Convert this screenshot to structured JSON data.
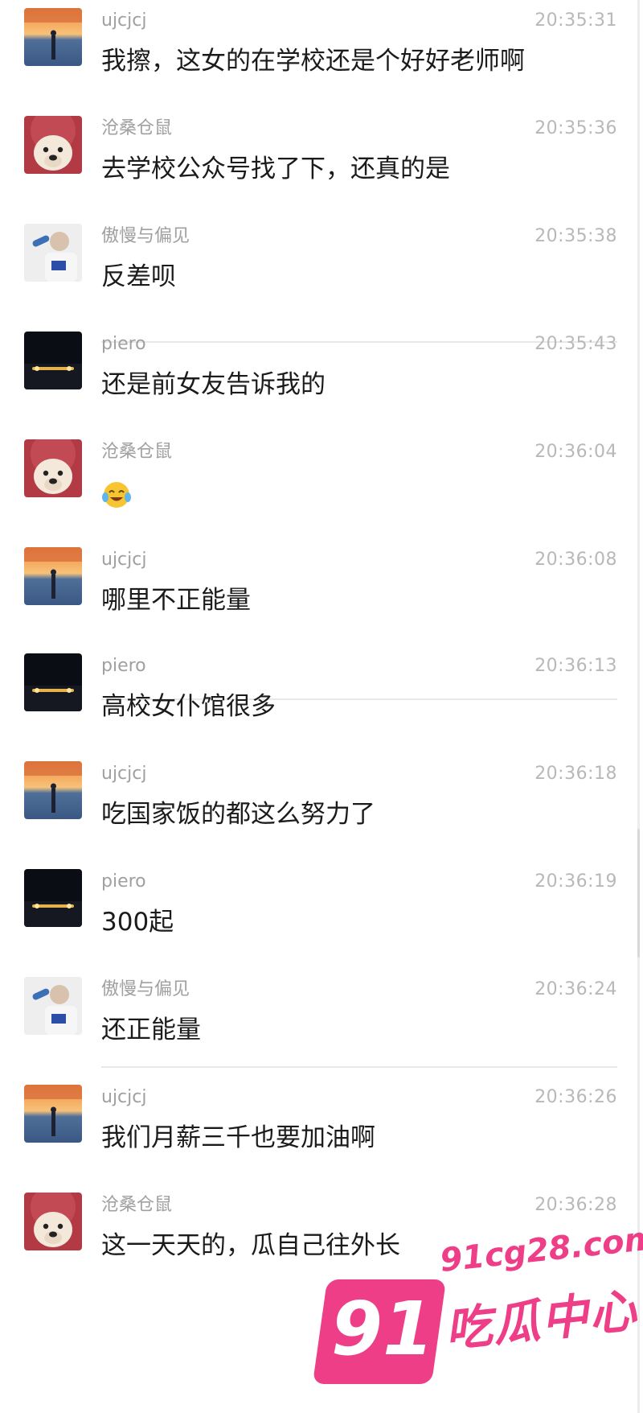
{
  "messages": [
    {
      "name": "ujcjcj",
      "time": "20:35:31",
      "text": "我擦，这女的在学校还是个好好老师啊",
      "avatar_icon": "sunset-silhouette-avatar"
    },
    {
      "name": "沧桑仓鼠",
      "time": "20:35:36",
      "text": "去学校公众号找了下，还真的是",
      "avatar_icon": "dog-red-hat-avatar"
    },
    {
      "name": "傲慢与偏见",
      "time": "20:35:38",
      "text": "反差呗",
      "avatar_icon": "man-drinking-avatar"
    },
    {
      "name": "piero",
      "time": "20:35:43",
      "text": "还是前女友告诉我的",
      "avatar_icon": "night-car-lights-avatar"
    },
    {
      "name": "沧桑仓鼠",
      "time": "20:36:04",
      "text": "",
      "emoji": "laughing-crying-emoji",
      "avatar_icon": "dog-red-hat-avatar"
    },
    {
      "name": "ujcjcj",
      "time": "20:36:08",
      "text": "哪里不正能量",
      "avatar_icon": "sunset-silhouette-avatar"
    },
    {
      "name": "piero",
      "time": "20:36:13",
      "text": "高校女仆馆很多",
      "avatar_icon": "night-car-lights-avatar"
    },
    {
      "name": "ujcjcj",
      "time": "20:36:18",
      "text": "吃国家饭的都这么努力了",
      "avatar_icon": "sunset-silhouette-avatar"
    },
    {
      "name": "piero",
      "time": "20:36:19",
      "text": "300起",
      "avatar_icon": "night-car-lights-avatar"
    },
    {
      "name": "傲慢与偏见",
      "time": "20:36:24",
      "text": "还正能量",
      "avatar_icon": "man-drinking-avatar"
    },
    {
      "name": "ujcjcj",
      "time": "20:36:26",
      "text": "我们月薪三千也要加油啊",
      "avatar_icon": "sunset-silhouette-avatar"
    },
    {
      "name": "沧桑仓鼠",
      "time": "20:36:28",
      "text": "这一天天的，瓜自己往外长",
      "avatar_icon": "dog-red-hat-avatar"
    }
  ],
  "watermark": {
    "number": "91",
    "url": "91cg28.com",
    "text": "吃瓜中心",
    "color": "#ee3e87"
  },
  "colors": {
    "name": "#a0a0a0",
    "time": "#b8b8b8",
    "text": "#1b1b1b",
    "divider": "#e8e8e8"
  }
}
